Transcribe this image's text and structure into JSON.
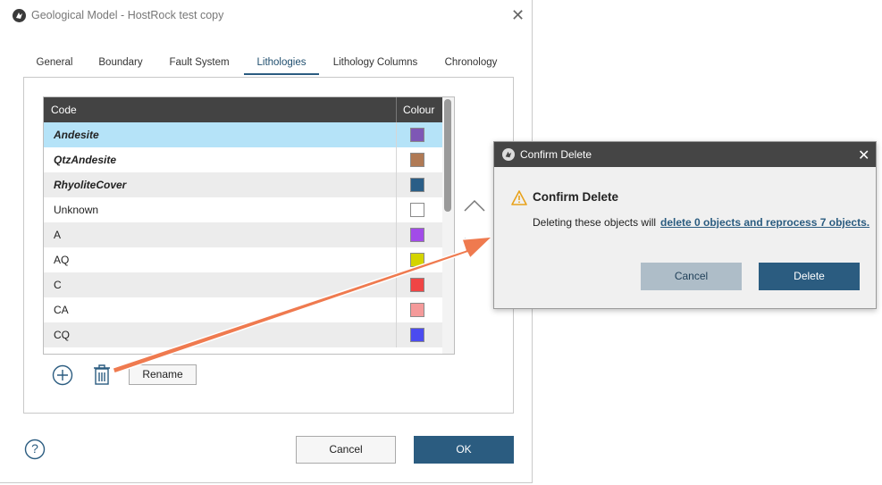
{
  "main_dialog": {
    "title": "Geological Model - HostRock test copy",
    "tabs": [
      "General",
      "Boundary",
      "Fault System",
      "Lithologies",
      "Lithology Columns",
      "Chronology"
    ],
    "active_tab": "Lithologies",
    "table": {
      "headers": {
        "code": "Code",
        "colour": "Colour"
      },
      "rows": [
        {
          "code": "Andesite",
          "colour": "#7e57b5"
        },
        {
          "code": "QtzAndesite",
          "colour": "#b07a55"
        },
        {
          "code": "RhyoliteCover",
          "colour": "#2a5e87"
        },
        {
          "code": "Unknown",
          "colour": "#ffffff"
        },
        {
          "code": "A",
          "colour": "#a24be8"
        },
        {
          "code": "AQ",
          "colour": "#d4d400"
        },
        {
          "code": "C",
          "colour": "#f04545"
        },
        {
          "code": "CA",
          "colour": "#f49a9a"
        },
        {
          "code": "CQ",
          "colour": "#4b4bf0"
        }
      ]
    },
    "rename_label": "Rename",
    "cancel_label": "Cancel",
    "ok_label": "OK",
    "help_label": "?"
  },
  "confirm_dialog": {
    "title": "Confirm Delete",
    "heading": "Confirm Delete",
    "message": "Deleting these objects will",
    "link": "delete 0 objects and reprocess 7 objects.",
    "cancel_label": "Cancel",
    "delete_label": "Delete"
  },
  "colors": {
    "primary": "#2b5c80",
    "selection": "#b5e3f8",
    "header_dark": "#434343",
    "annotation_arrow": "#ef7a4f"
  }
}
